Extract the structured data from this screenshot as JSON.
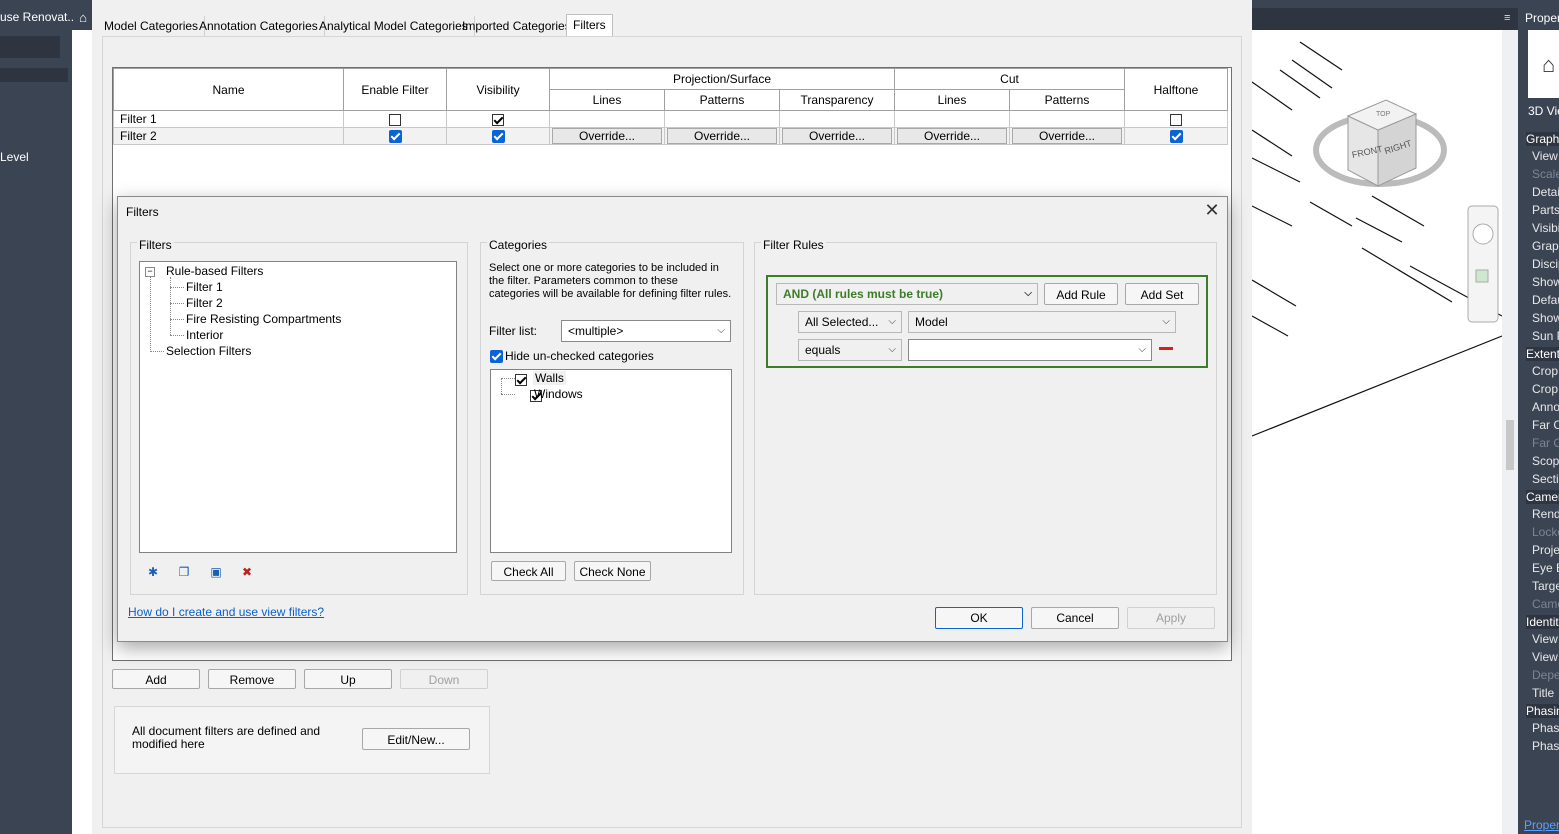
{
  "app": {
    "project_title": "use Renovat...",
    "level_label": "Level"
  },
  "vg_dialog": {
    "tabs": [
      "Model Categories",
      "Annotation Categories",
      "Analytical Model Categories",
      "Imported Categories",
      "Filters"
    ],
    "active_tab": "Filters",
    "table": {
      "headers": {
        "name": "Name",
        "enable_filter": "Enable Filter",
        "visibility": "Visibility",
        "projection_surface": "Projection/Surface",
        "cut": "Cut",
        "halftone": "Halftone",
        "lines": "Lines",
        "patterns": "Patterns",
        "transparency": "Transparency",
        "cut_lines": "Lines",
        "cut_patterns": "Patterns"
      },
      "rows": [
        {
          "name": "Filter 1",
          "enable": false,
          "visible": true,
          "halftone": false,
          "override": ""
        },
        {
          "name": "Filter 2",
          "enable": true,
          "visible": true,
          "halftone": true,
          "override": "Override..."
        }
      ]
    },
    "buttons": {
      "add": "Add",
      "remove": "Remove",
      "up": "Up",
      "down": "Down",
      "edit_new": "Edit/New..."
    },
    "note": "All document filters are defined and modified here"
  },
  "filters_dialog": {
    "title": "Filters",
    "filters_group": "Filters",
    "tree": {
      "root": "Rule-based Filters",
      "children": [
        "Filter 1",
        "Filter 2",
        "Fire Resisting Compartments",
        "Interior"
      ],
      "selection": "Selection Filters"
    },
    "categories_group": "Categories",
    "categories_desc": [
      "Select one or more categories to be included in",
      "the filter.  Parameters common to these",
      "categories will be available for defining filter rules."
    ],
    "filter_list_label": "Filter list:",
    "filter_list_value": "<multiple>",
    "hide_unchecked_label": "Hide un-checked categories",
    "categories": [
      "Walls",
      "Windows"
    ],
    "check_all": "Check All",
    "check_none": "Check None",
    "rules_group": "Filter Rules",
    "rule_set_value": "AND (All rules must be true)",
    "add_rule": "Add Rule",
    "add_set": "Add Set",
    "rule_category": "All Selected...",
    "rule_param": "Model",
    "rule_operator": "equals",
    "rule_value": "",
    "help_link": "How do I create and use view filters?",
    "ok": "OK",
    "cancel": "Cancel",
    "apply": "Apply"
  },
  "properties": {
    "title": "Proper",
    "view_type": "3D Vie",
    "sections": [
      {
        "header": "Graph",
        "rows": [
          "View",
          "Scale",
          "Detai",
          "Parts",
          "Visibi",
          "Graph",
          "Discip",
          "Show",
          "Defau",
          "Show",
          "Sun P"
        ]
      },
      {
        "header": "Extent",
        "rows": [
          "Crop",
          "Crop",
          "Anno",
          "Far C",
          "Far C",
          "Scop",
          "Sectio"
        ]
      },
      {
        "header": "Camer",
        "rows": [
          "Rend",
          "Locke",
          "Proje",
          "Eye E",
          "Targe",
          "Came"
        ]
      },
      {
        "header": "Identit",
        "rows": [
          "View",
          "View",
          "Depe",
          "Title"
        ]
      },
      {
        "header": "Phasin",
        "rows": [
          "Phase",
          "Phase"
        ]
      }
    ],
    "footer": "Proper"
  },
  "viewcube": {
    "front": "FRONT",
    "right": "RIGHT",
    "top": "TOP"
  }
}
